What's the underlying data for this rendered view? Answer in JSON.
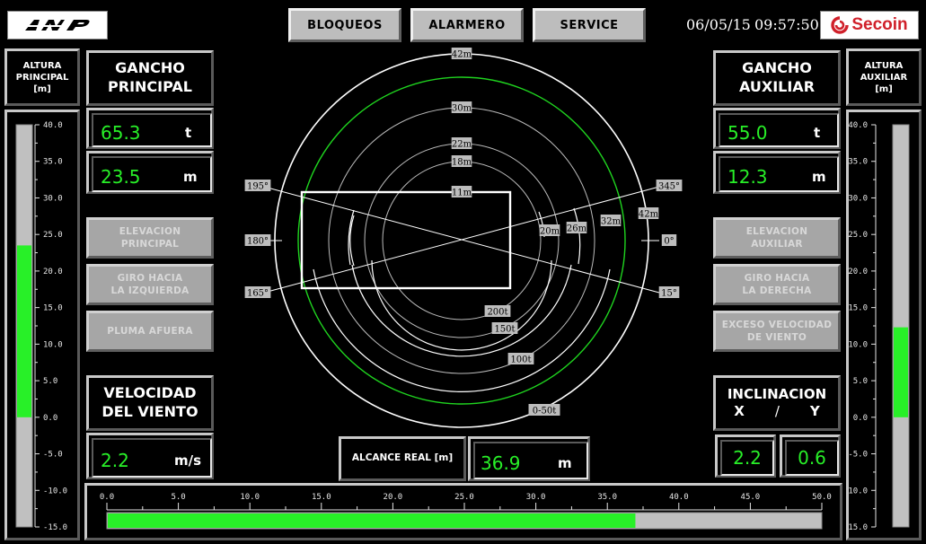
{
  "header": {
    "nav": [
      "BLOQUEOS",
      "ALARMERO",
      "SERVICE"
    ],
    "date": "06/05/15",
    "time": "09:57:50",
    "brand": "Secoin"
  },
  "left": {
    "altura_title": [
      "ALTURA",
      "PRINCIPAL",
      "[m]"
    ],
    "gancho_title": [
      "GANCHO",
      "PRINCIPAL"
    ],
    "load": "65.3",
    "load_unit": "t",
    "height": "23.5",
    "height_unit": "m",
    "buttons": [
      [
        "ELEVACION",
        "PRINCIPAL"
      ],
      [
        "GIRO HACIA",
        "LA IZQUIERDA"
      ],
      [
        "PLUMA AFUERA"
      ]
    ],
    "wind_title": [
      "VELOCIDAD",
      "DEL VIENTO"
    ],
    "wind": "2.2",
    "wind_unit": "m/s",
    "scale_labels": [
      "40.0",
      "35.0",
      "30.0",
      "25.0",
      "20.0",
      "15.0",
      "10.0",
      "5.0",
      "0.0",
      "-5.0",
      "-10.0",
      "-15.0"
    ],
    "bar_value": 23.5
  },
  "right": {
    "altura_title": [
      "ALTURA",
      "AUXILIAR",
      "[m]"
    ],
    "gancho_title": [
      "GANCHO",
      "AUXILIAR"
    ],
    "load": "55.0",
    "load_unit": "t",
    "height": "12.3",
    "height_unit": "m",
    "buttons": [
      [
        "ELEVACION",
        "AUXILIAR"
      ],
      [
        "GIRO HACIA",
        "LA DERECHA"
      ],
      [
        "EXCESO VELOCIDAD",
        "DE VIENTO"
      ]
    ],
    "incl_title": [
      "INCLINACION"
    ],
    "incl_axes": [
      "X",
      "/",
      "Y"
    ],
    "incl_x": "2.2",
    "incl_y": "0.6",
    "scale_labels": [
      "40.0",
      "35.0",
      "30.0",
      "25.0",
      "20.0",
      "15.0",
      "10.0",
      "5.0",
      "0.0",
      "-5.0",
      "-10.0",
      "-15.0"
    ],
    "bar_value": 12.3
  },
  "radar": {
    "radius_labels": [
      "42m",
      "30m",
      "22m",
      "18m",
      "11m"
    ],
    "angle_labels": [
      "195°",
      "180°",
      "165°",
      "345°",
      "0°",
      "15°"
    ],
    "arc_labels": [
      "20m",
      "26m",
      "32m",
      "42m"
    ],
    "capacity_labels": [
      "200t",
      "150t",
      "100t",
      "0-50t"
    ]
  },
  "alcance": {
    "label": "ALCANCE REAL [m]",
    "value": "36.9",
    "unit": "m"
  },
  "reach_scale": {
    "labels": [
      "0.0",
      "5.0",
      "10.0",
      "15.0",
      "20.0",
      "25.0",
      "30.0",
      "35.0",
      "40.0",
      "45.0",
      "50.0"
    ],
    "value": 36.9,
    "max": 50
  },
  "colors": {
    "accent": "#28f028",
    "brand": "#d0202a"
  }
}
